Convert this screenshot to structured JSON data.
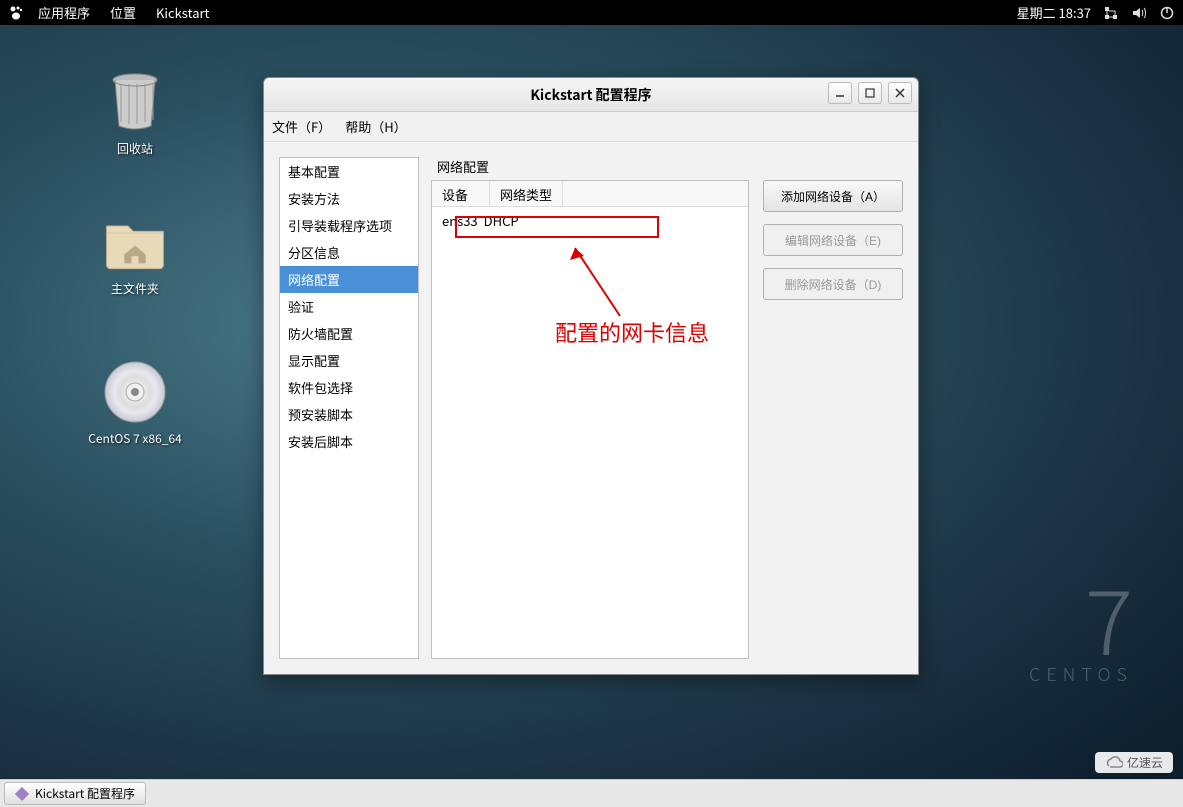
{
  "panel": {
    "apps": "应用程序",
    "places": "位置",
    "appname": "Kickstart",
    "clock": "星期二 18:37"
  },
  "desktop": {
    "trash": "回收站",
    "home": "主文件夹",
    "cd": "CentOS 7 x86_64"
  },
  "centos": {
    "seven": "7",
    "name": "CENTOS"
  },
  "window": {
    "title": "Kickstart 配置程序",
    "menu_file": "文件（F）",
    "menu_help": "帮助（H）"
  },
  "sidebar": {
    "items": [
      "基本配置",
      "安装方法",
      "引导装载程序选项",
      "分区信息",
      "网络配置",
      "验证",
      "防火墙配置",
      "显示配置",
      "软件包选择",
      "预安装脚本",
      "安装后脚本"
    ],
    "selected_index": 4
  },
  "panel_label": "网络配置",
  "table": {
    "col_device": "设备",
    "col_type": "网络类型",
    "rows": [
      {
        "device": "ens33",
        "type": "DHCP"
      }
    ]
  },
  "buttons": {
    "add": "添加网络设备（A）",
    "edit": "编辑网络设备（E)",
    "delete": "删除网络设备（D)"
  },
  "annotation": "配置的网卡信息",
  "taskbar": {
    "item": "Kickstart 配置程序"
  },
  "brand": "亿速云"
}
